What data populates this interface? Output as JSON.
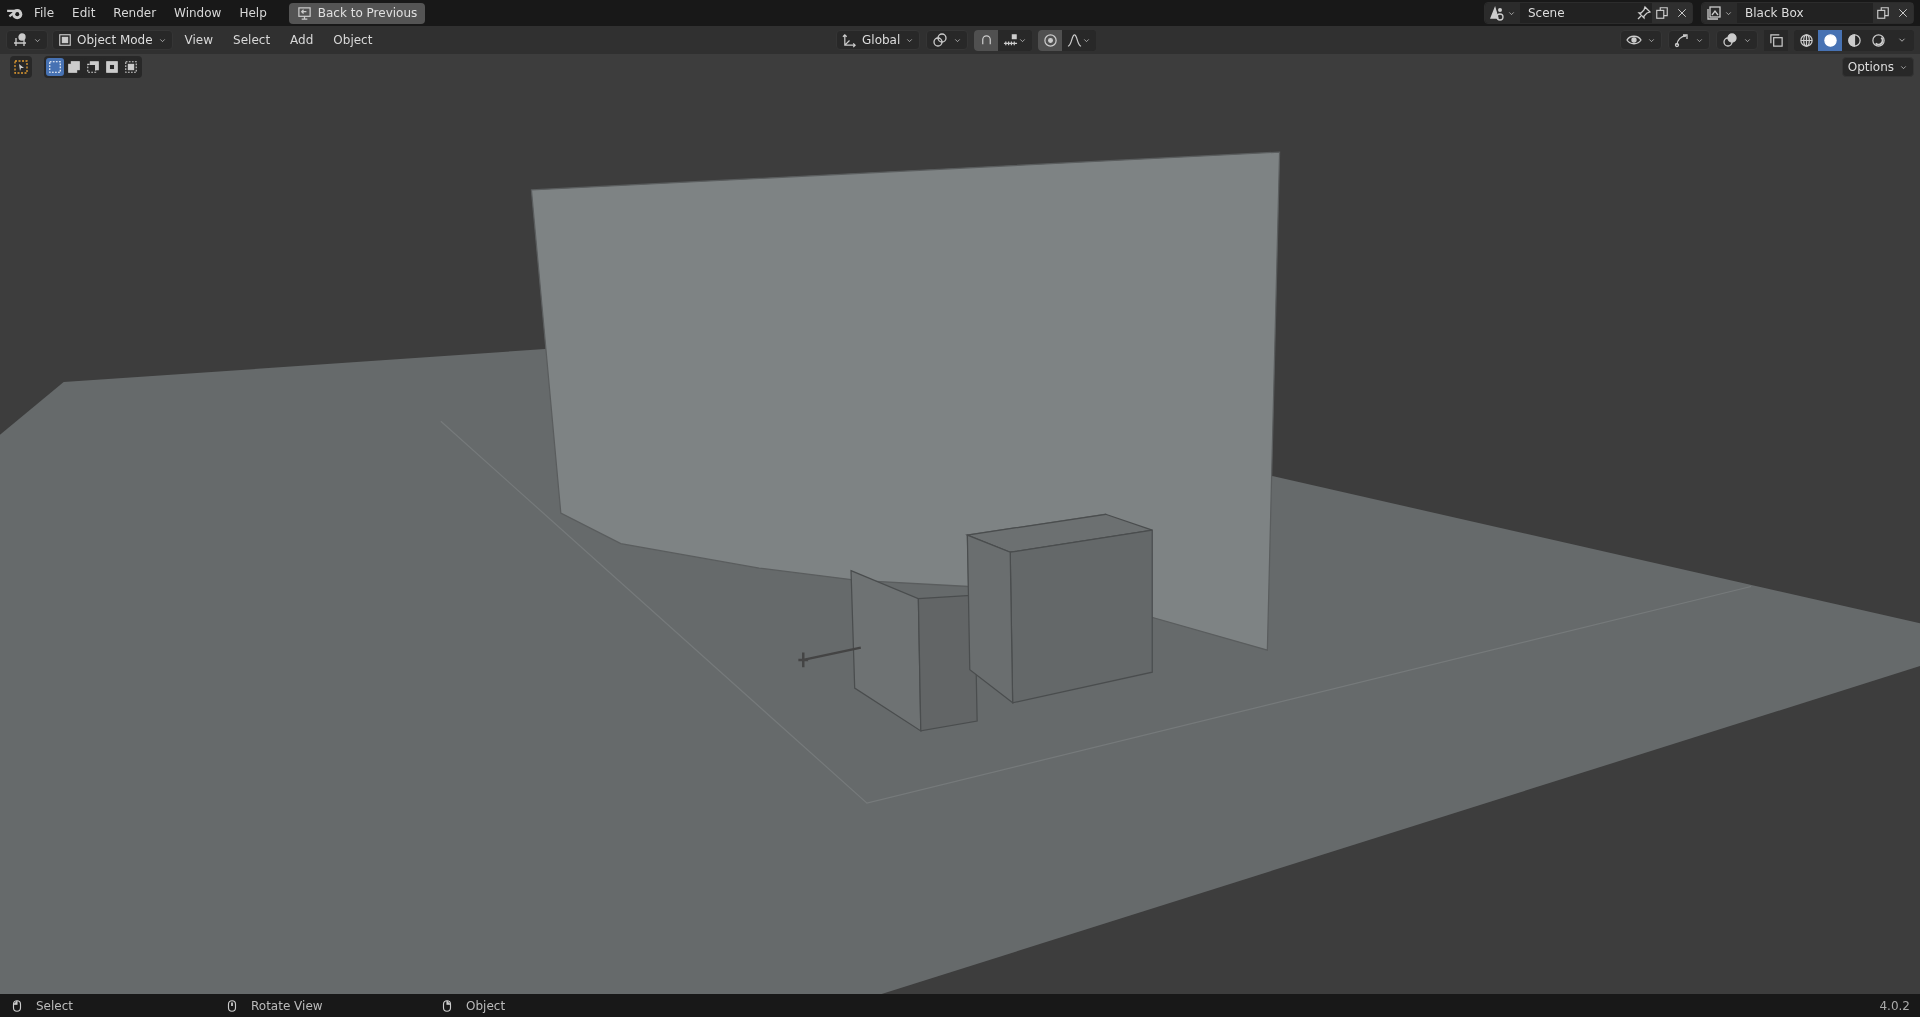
{
  "topbar": {
    "menus": [
      "File",
      "Edit",
      "Render",
      "Window",
      "Help"
    ],
    "back_button": "Back to Previous",
    "scene": {
      "name": "Scene"
    },
    "view_layer": {
      "name": "Black Box"
    }
  },
  "header": {
    "mode": "Object Mode",
    "menus": [
      "View",
      "Select",
      "Add",
      "Object"
    ],
    "orientation": "Global",
    "snap": {
      "on": false
    },
    "proportional": {
      "on": false
    },
    "shading_modes": [
      {
        "kind": "wireframe",
        "selected": false
      },
      {
        "kind": "solid",
        "selected": true
      },
      {
        "kind": "material",
        "selected": false
      },
      {
        "kind": "rendered",
        "selected": false
      }
    ],
    "options": "Options"
  },
  "select_modes": [
    {
      "kind": "set",
      "selected": true
    },
    {
      "kind": "extend",
      "selected": false
    },
    {
      "kind": "subtract",
      "selected": false
    },
    {
      "kind": "difference",
      "selected": false
    },
    {
      "kind": "intersect",
      "selected": false
    }
  ],
  "status_bar": {
    "hints": [
      {
        "kind": "left",
        "label": "Select"
      },
      {
        "kind": "middle",
        "label": "Rotate View"
      },
      {
        "kind": "right",
        "label": "Object"
      }
    ],
    "version": "4.0.2"
  }
}
